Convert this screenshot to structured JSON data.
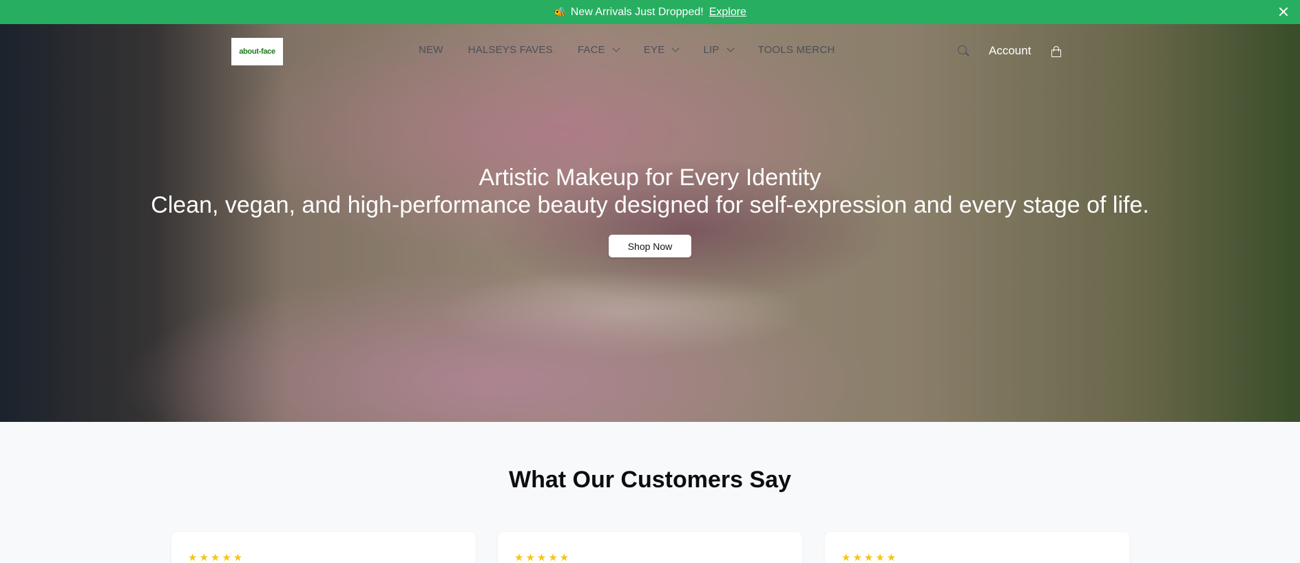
{
  "announcement": {
    "emoji": "🐝",
    "message": "New Arrivals Just Dropped!",
    "link_label": "Explore",
    "background": "#27ae60"
  },
  "header": {
    "logo_text": "about-face",
    "nav": [
      {
        "label": "NEW",
        "dropdown": false
      },
      {
        "label": "HALSEYS FAVES",
        "dropdown": false
      },
      {
        "label": "FACE",
        "dropdown": true
      },
      {
        "label": "EYE",
        "dropdown": true
      },
      {
        "label": "LIP",
        "dropdown": true
      },
      {
        "label": "TOOLS MERCH",
        "dropdown": false
      }
    ],
    "search_icon": "search-icon",
    "account_label": "Account",
    "cart_icon": "shopping-bag-icon"
  },
  "hero": {
    "title": "Artistic Makeup for Every Identity",
    "subtitle": "Clean, vegan, and high-performance beauty designed for self-expression and every stage of life.",
    "cta_label": "Shop Now"
  },
  "testimonials": {
    "title": "What Our Customers Say",
    "cards": [
      {
        "stars": "★★★★★"
      },
      {
        "stars": "★★★★★"
      },
      {
        "stars": "★★★★★"
      }
    ],
    "star_color": "#f5c518"
  }
}
